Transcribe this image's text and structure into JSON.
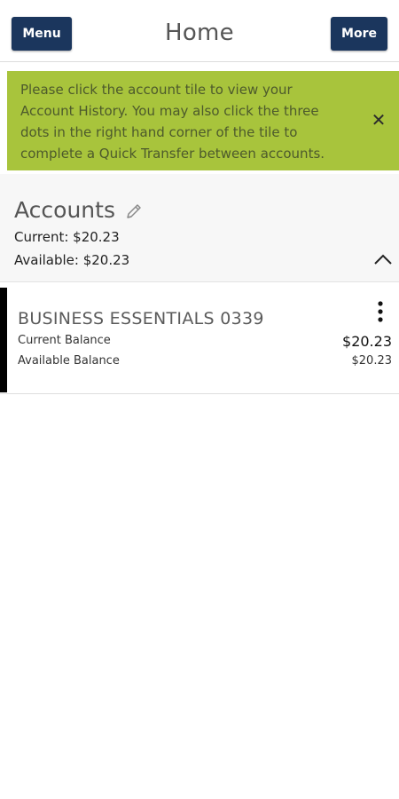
{
  "colors": {
    "header_button_bg": "#1b365d",
    "banner_bg": "#a8c43c",
    "tile_accent": "#000000"
  },
  "header": {
    "menu_label": "Menu",
    "title": "Home",
    "more_label": "More"
  },
  "banner": {
    "text": "Please click the account tile to view your Account History. You may also click the three dots in the right hand corner of the tile to complete a Quick Transfer between accounts.",
    "close_icon": "close-icon",
    "close_glyph": "✕"
  },
  "accounts": {
    "heading": "Accounts",
    "edit_icon": "pencil-icon",
    "current": "Current: $20.23",
    "available": "Available: $20.23",
    "collapse_icon": "chevron-up-icon"
  },
  "tiles": [
    {
      "name": "BUSINESS ESSENTIALS 0339",
      "current_label": "Current Balance",
      "current_value": "$20.23",
      "available_label": "Available Balance",
      "available_value": "$20.23",
      "menu_icon": "more-vertical-icon"
    }
  ]
}
